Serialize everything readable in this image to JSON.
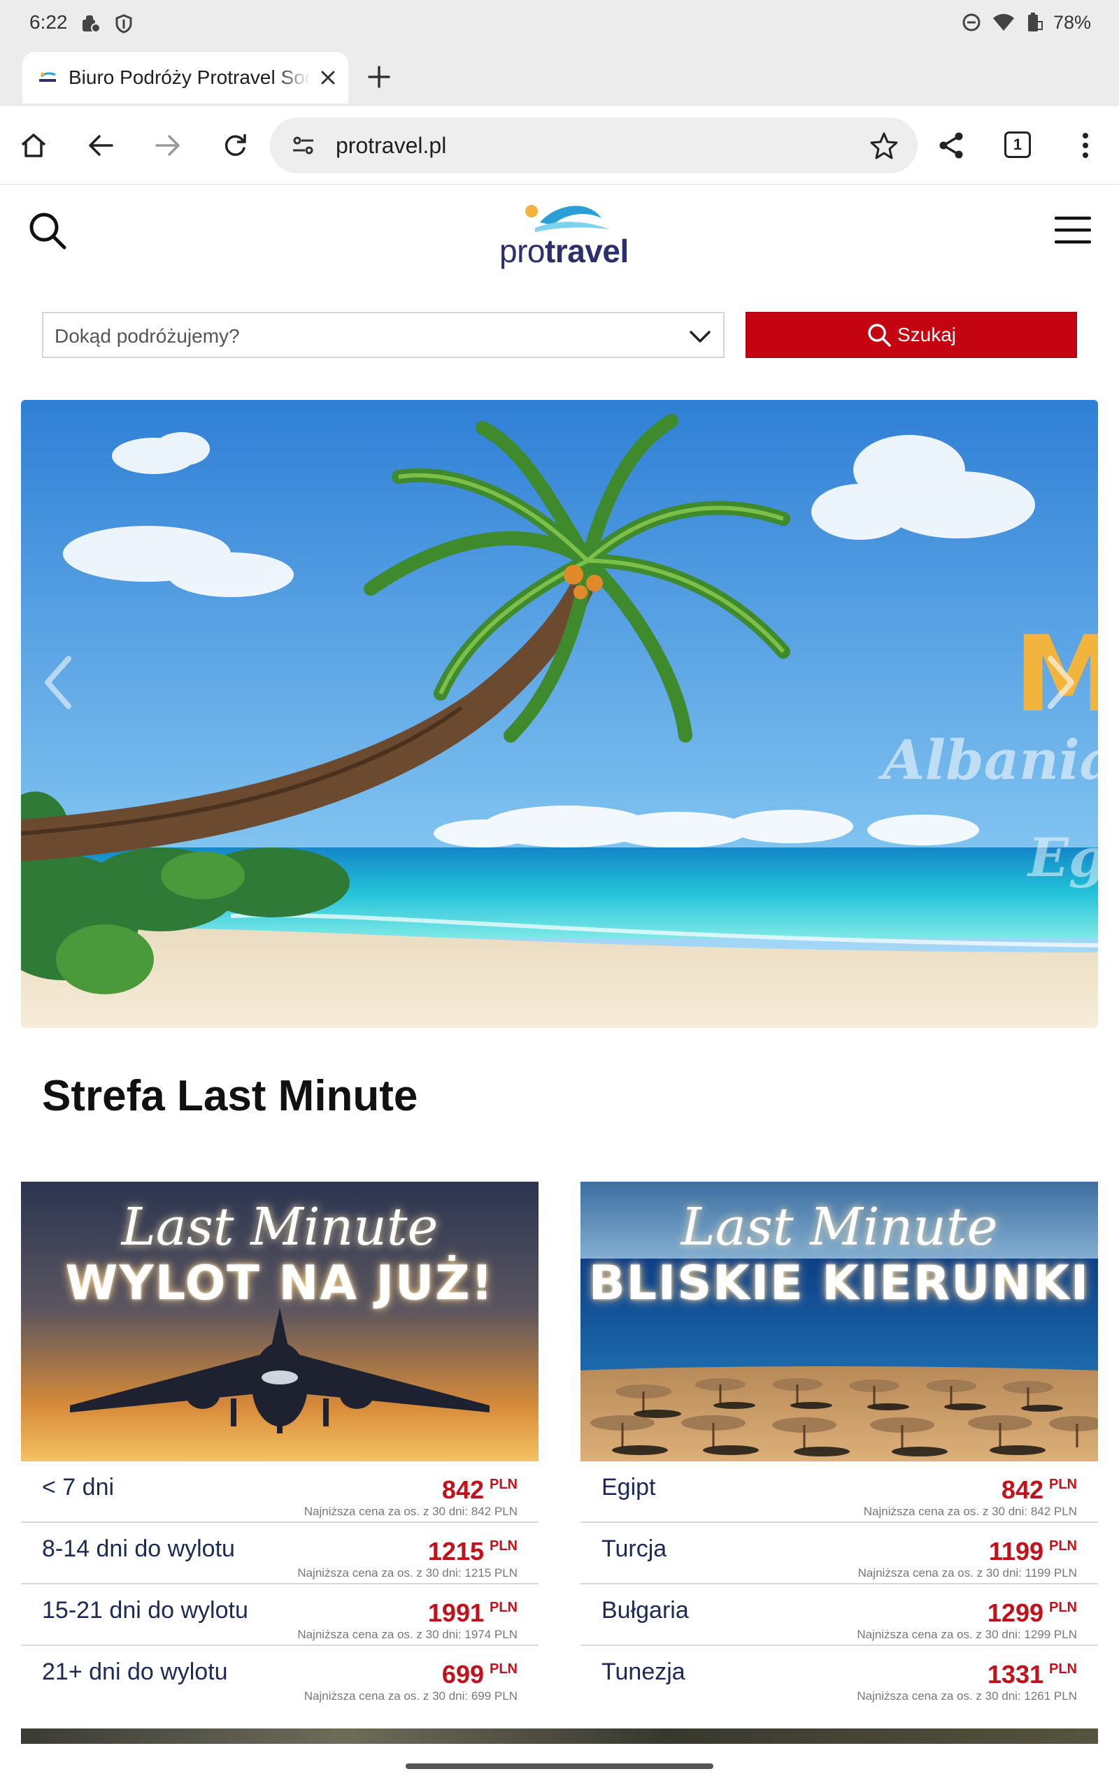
{
  "status_bar": {
    "time": "6:22",
    "battery": "78%"
  },
  "browser": {
    "tab_title": "Biuro Podróży Protravel Sochaczew",
    "url": "protravel.pl",
    "tab_count": "1"
  },
  "site": {
    "logo_pro": "pro",
    "logo_travel": "travel",
    "search_placeholder": "Dokąd podróżujemy?",
    "search_button": "Szukaj"
  },
  "hero": {
    "overlay_texts": [
      "Albania",
      "Eg",
      "M"
    ]
  },
  "section": {
    "title": "Strefa Last Minute"
  },
  "cards": [
    {
      "script": "Last Minute",
      "headline": "WYLOT NA JUŻ!",
      "rows": [
        {
          "label": "< 7 dni",
          "price": "842",
          "currency": "PLN",
          "note": "Najniższa cena za os. z 30 dni: 842 PLN"
        },
        {
          "label": "8-14 dni do wylotu",
          "price": "1215",
          "currency": "PLN",
          "note": "Najniższa cena za os. z 30 dni: 1215 PLN"
        },
        {
          "label": "15-21 dni do wylotu",
          "price": "1991",
          "currency": "PLN",
          "note": "Najniższa cena za os. z 30 dni: 1974 PLN"
        },
        {
          "label": "21+ dni do wylotu",
          "price": "699",
          "currency": "PLN",
          "note": "Najniższa cena za os. z 30 dni: 699 PLN"
        }
      ]
    },
    {
      "script": "Last Minute",
      "headline": "BLISKIE KIERUNKI",
      "rows": [
        {
          "label": "Egipt",
          "price": "842",
          "currency": "PLN",
          "note": "Najniższa cena za os. z 30 dni: 842 PLN"
        },
        {
          "label": "Turcja",
          "price": "1199",
          "currency": "PLN",
          "note": "Najniższa cena za os. z 30 dni: 1199 PLN"
        },
        {
          "label": "Bułgaria",
          "price": "1299",
          "currency": "PLN",
          "note": "Najniższa cena za os. z 30 dni: 1299 PLN"
        },
        {
          "label": "Tunezja",
          "price": "1331",
          "currency": "PLN",
          "note": "Najniższa cena za os. z 30 dni: 1261 PLN"
        }
      ]
    }
  ],
  "colors": {
    "accent_red": "#c40511",
    "price_red": "#c1121c",
    "logo_navy": "#2b2f6e",
    "logo_wave": "#2a9fd6",
    "logo_sun": "#f2b43c"
  },
  "icons": {
    "status": [
      "notification-icon",
      "vpn-shield-icon",
      "dnd-icon",
      "wifi-icon",
      "battery-icon"
    ],
    "toolbar": [
      "home-icon",
      "back-arrow-icon",
      "forward-arrow-icon",
      "reload-icon",
      "site-settings-icon",
      "bookmark-star-icon",
      "share-icon",
      "tab-switcher-icon",
      "overflow-menu-icon"
    ]
  }
}
